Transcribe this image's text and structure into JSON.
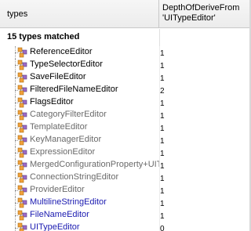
{
  "header": {
    "types_label": "types",
    "depth_label_line1": "DepthOfDeriveFrom",
    "depth_label_line2": "'UITypeEditor'"
  },
  "summary": {
    "text": "15 types matched"
  },
  "rows": [
    {
      "name": "ReferenceEditor",
      "value": "1",
      "style": "normal"
    },
    {
      "name": "TypeSelectorEditor",
      "value": "1",
      "style": "normal"
    },
    {
      "name": "SaveFileEditor",
      "value": "1",
      "style": "normal"
    },
    {
      "name": "FilteredFileNameEditor",
      "value": "2",
      "style": "normal"
    },
    {
      "name": "FlagsEditor",
      "value": "1",
      "style": "normal"
    },
    {
      "name": "CategoryFilterEditor",
      "value": "1",
      "style": "dim"
    },
    {
      "name": "TemplateEditor",
      "value": "1",
      "style": "dim"
    },
    {
      "name": "KeyManagerEditor",
      "value": "1",
      "style": "dim"
    },
    {
      "name": "ExpressionEditor",
      "value": "1",
      "style": "dim"
    },
    {
      "name": "MergedConfigurationProperty+UIT",
      "value": "1",
      "style": "dim"
    },
    {
      "name": "ConnectionStringEditor",
      "value": "1",
      "style": "dim"
    },
    {
      "name": "ProviderEditor",
      "value": "1",
      "style": "dim"
    },
    {
      "name": "MultilineStringEditor",
      "value": "1",
      "style": "link"
    },
    {
      "name": "FileNameEditor",
      "value": "1",
      "style": "link"
    },
    {
      "name": "UITypeEditor",
      "value": "0",
      "style": "link"
    }
  ],
  "colors": {
    "normal_text": "#000000",
    "dim_text": "#6a6a6a",
    "link_text": "#1a1ab0",
    "icon_orange": "#f2a13a",
    "icon_purple": "#9b6bc7"
  },
  "icons": {
    "type_icon": "class-type-icon"
  }
}
